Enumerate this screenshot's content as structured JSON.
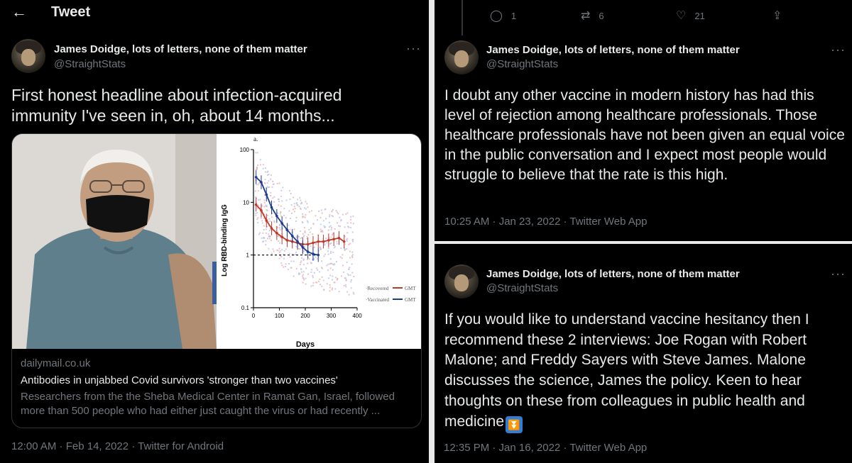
{
  "header": {
    "title": "Tweet"
  },
  "author": {
    "name": "James Doidge, lots of letters, none of them matter",
    "handle": "@StraightStats"
  },
  "main_tweet": {
    "text": "First honest headline about infection-acquired immunity I've seen in, oh, about 14 months...",
    "card": {
      "domain": "dailymail.co.uk",
      "title": "Antibodies in unjabbed Covid survivors 'stronger than two vaccines'",
      "description": "Researchers from the the Sheba Medical Center in Ramat Gan, Israel, followed more than 500 people who had either just caught the virus or had recently ...",
      "chart_data": {
        "type": "line",
        "panel_label": "a.",
        "xlabel": "Days",
        "ylabel": "Log RBD-binding IgG",
        "x_ticks": [
          "0",
          "100",
          "200",
          "300",
          "400"
        ],
        "y_ticks": [
          "100",
          "10",
          "1",
          "0.1"
        ],
        "xlim": [
          0,
          400
        ],
        "ylim": [
          0.1,
          100
        ],
        "log_y": true,
        "legend": [
          {
            "label": "Recovered",
            "tag": "GMT",
            "color": "#c0392b"
          },
          {
            "label": "Vaccinated",
            "tag": "GMT",
            "color": "#1f3b8f"
          }
        ],
        "series": [
          {
            "name": "Recovered",
            "x": [
              10,
              30,
              50,
              70,
              90,
              110,
              130,
              150,
              170,
              190,
              210,
              230,
              250,
              270,
              290,
              310,
              330,
              350
            ],
            "y": [
              9,
              7,
              4.5,
              3.2,
              2.6,
              2.2,
              1.9,
              1.8,
              1.7,
              1.6,
              1.6,
              1.7,
              1.8,
              1.8,
              1.9,
              2.0,
              2.1,
              1.8
            ]
          },
          {
            "name": "Vaccinated",
            "x": [
              10,
              30,
              50,
              70,
              90,
              110,
              130,
              150,
              170,
              190,
              210,
              230,
              250
            ],
            "y": [
              30,
              24,
              14,
              8,
              5.5,
              4,
              3,
              2.3,
              1.8,
              1.4,
              1.15,
              1.05,
              1.0
            ]
          }
        ]
      }
    },
    "meta": "12:00 AM · Feb 14, 2022 · Twitter for Android"
  },
  "reply_actions": {
    "reply_count": "1",
    "retweet_count": "6",
    "like_count": "21"
  },
  "tweet2": {
    "text": "I doubt any other vaccine in modern history has had this level of rejection among healthcare professionals. Those healthcare professionals have not been given an equal voice in the public conversation and I expect most people would struggle to believe that the rate is this high.",
    "meta": "10:25 AM · Jan 23, 2022 · Twitter Web App"
  },
  "tweet3": {
    "text": "If you would like to understand vaccine hesitancy then I recommend these 2 interviews: Joe Rogan with Robert Malone; and Freddy Sayers with Steve James. Malone discusses the science, James the policy. Keen to hear thoughts on these from colleagues in public health and medicine",
    "meta": "12:35 PM · Jan 16, 2022 · Twitter Web App"
  }
}
